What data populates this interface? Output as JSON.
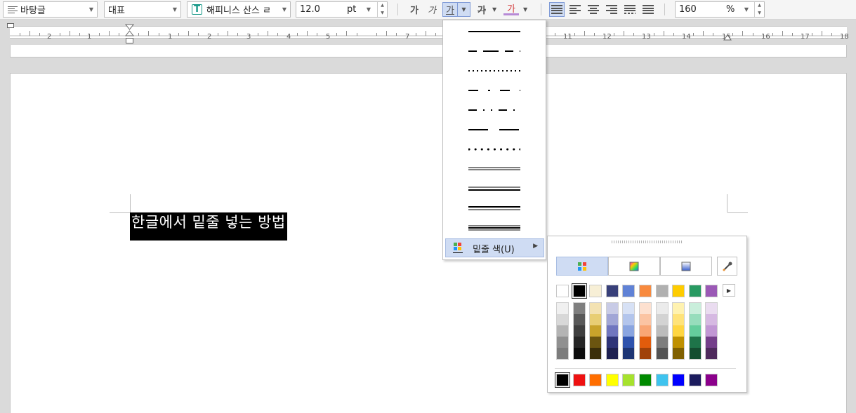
{
  "toolbar": {
    "style_combo": "바탕글",
    "language_combo": "대표",
    "font_combo": "해피니스 산스 ㄹ",
    "font_icon_label": "T",
    "size_value": "12.0",
    "size_unit": "pt",
    "bold_glyph": "가",
    "italic_glyph": "가",
    "underline_glyph": "가",
    "strike_glyph": "가",
    "color_glyph": "가",
    "zoom_value": "160",
    "zoom_unit": "%",
    "accent_color": "#3b5cc4"
  },
  "ruler": {
    "labels": [
      "2",
      "1",
      "1",
      "2",
      "3",
      "4",
      "5",
      "7",
      "11",
      "12",
      "13",
      "14",
      "15",
      "16",
      "17",
      "18"
    ]
  },
  "document": {
    "selected_text": "한글에서 밑줄 넣는 방법"
  },
  "underline_menu": {
    "styles": [
      "solid",
      "long-dash",
      "dotted",
      "dash-dot",
      "dash-dot-dot",
      "long-dash-gap",
      "circle-dots",
      "double-thin",
      "thick-thin",
      "thin-thick",
      "triple"
    ],
    "color_label": "밑줄 색(U)"
  },
  "color_panel": {
    "tabs": [
      "palette",
      "spectrum",
      "gradient"
    ],
    "base_colors": [
      "#ffffff",
      "#000000",
      "#f7efd6",
      "#38407a",
      "#6082d6",
      "#f88a3e",
      "#b0b0b0",
      "#fecc00",
      "#289a62",
      "#9b59b6"
    ],
    "shade_columns": [
      [
        "#f0f0f0",
        "#d8d8d8",
        "#b4b4b4",
        "#909090",
        "#7c7c7c"
      ],
      [
        "#7f7f7f",
        "#595959",
        "#3f3f3f",
        "#262626",
        "#0d0d0d"
      ],
      [
        "#f3e2b2",
        "#e8ce74",
        "#c8a32b",
        "#6b5510",
        "#3a2e0a"
      ],
      [
        "#c8cbe6",
        "#a1a6d6",
        "#7076bf",
        "#2e3478",
        "#1d2050"
      ],
      [
        "#d7e1f5",
        "#b3c5ec",
        "#8aa5e0",
        "#2f53ad",
        "#1d3574"
      ],
      [
        "#fde0cf",
        "#fbc4a3",
        "#f9a675",
        "#e25c0c",
        "#a0420a"
      ],
      [
        "#ebebeb",
        "#d3d3d3",
        "#bcbcbc",
        "#7d7d7d",
        "#535353"
      ],
      [
        "#fff2b0",
        "#ffe37a",
        "#ffd642",
        "#bf9000",
        "#806000"
      ],
      [
        "#c9eedb",
        "#97ddbc",
        "#64cd9c",
        "#1e7449",
        "#144d30"
      ],
      [
        "#eadcf0",
        "#d6b9e2",
        "#c197d4",
        "#743f8a",
        "#4e2a5c"
      ]
    ],
    "standard_colors": [
      "#000000",
      "#ee1111",
      "#ff6e00",
      "#ffff00",
      "#a6e22e",
      "#008a00",
      "#3fc3ee",
      "#0000ff",
      "#1c1c5e",
      "#8b008b"
    ]
  }
}
